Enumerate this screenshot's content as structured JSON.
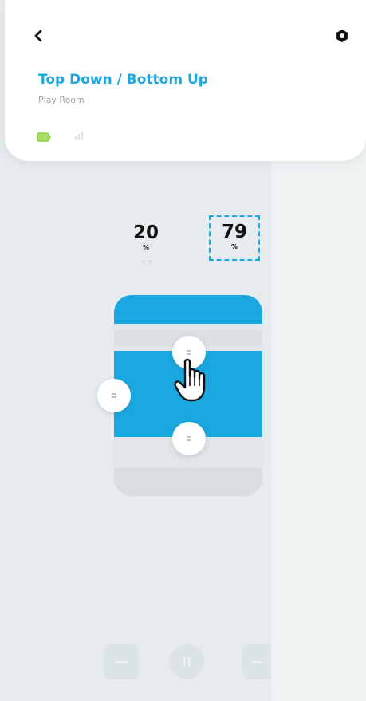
{
  "header": {
    "title": "Top Down / Bottom Up",
    "room": "Play Room",
    "back_icon": "chevron-left-icon",
    "settings_icon": "gear-icon",
    "battery_icon": "battery-icon",
    "battery_color": "#8cd03c",
    "signal_icon": "signal-icon"
  },
  "positions": {
    "top": {
      "value": "20",
      "unit": "%"
    },
    "bottom": {
      "value": "79",
      "unit": "%"
    }
  },
  "blind": {
    "accent_color": "#1ba8e0",
    "top_rail_position_pct": 20,
    "bottom_rail_position_pct": 79,
    "handles": [
      "drag-handle-top-icon",
      "drag-handle-left-icon",
      "drag-handle-bottom-icon"
    ]
  },
  "controls": {
    "left_icon": "minus-icon",
    "middle_icon": "pause-icon",
    "right_icon": "minus-icon"
  },
  "colors": {
    "accent": "#1ba8e0",
    "background": "#e6ecee",
    "text": "#111111"
  }
}
